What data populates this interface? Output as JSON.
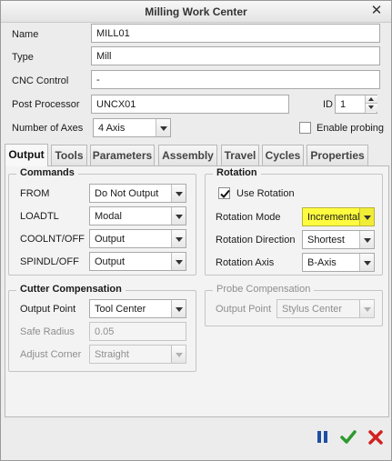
{
  "window": {
    "title": "Milling Work Center"
  },
  "form": {
    "name_label": "Name",
    "name_value": "MILL01",
    "type_label": "Type",
    "type_value": "Mill",
    "cnc_label": "CNC Control",
    "cnc_value": "-",
    "post_label": "Post Processor",
    "post_value": "UNCX01",
    "id_label": "ID",
    "id_value": "1",
    "axes_label": "Number of Axes",
    "axes_value": "4 Axis",
    "probing_label": "Enable probing",
    "probing_checked": false
  },
  "tabs": [
    {
      "label": "Output",
      "active": true
    },
    {
      "label": "Tools"
    },
    {
      "label": "Parameters"
    },
    {
      "label": "Assembly"
    },
    {
      "label": "Travel"
    },
    {
      "label": "Cycles"
    },
    {
      "label": "Properties"
    }
  ],
  "commands": {
    "title": "Commands",
    "from_label": "FROM",
    "from_value": "Do Not Output",
    "loadtl_label": "LOADTL",
    "loadtl_value": "Modal",
    "coolnt_label": "COOLNT/OFF",
    "coolnt_value": "Output",
    "spindl_label": "SPINDL/OFF",
    "spindl_value": "Output"
  },
  "rotation": {
    "title": "Rotation",
    "use_label": "Use Rotation",
    "use_checked": true,
    "mode_label": "Rotation Mode",
    "mode_value": "Incremental",
    "direction_label": "Rotation Direction",
    "direction_value": "Shortest",
    "axis_label": "Rotation Axis",
    "axis_value": "B-Axis",
    "highlight_color": "#fffc40"
  },
  "cutter": {
    "title": "Cutter Compensation",
    "output_label": "Output Point",
    "output_value": "Tool Center",
    "radius_label": "Safe Radius",
    "radius_value": "0.05",
    "corner_label": "Adjust Corner",
    "corner_value": "Straight"
  },
  "probe": {
    "title": "Probe Compensation",
    "output_label": "Output Point",
    "output_value": "Stylus Center"
  },
  "footer": {
    "pause_color": "#1f4fa3",
    "ok_color": "#2e9a2e",
    "cancel_color": "#d42020"
  }
}
